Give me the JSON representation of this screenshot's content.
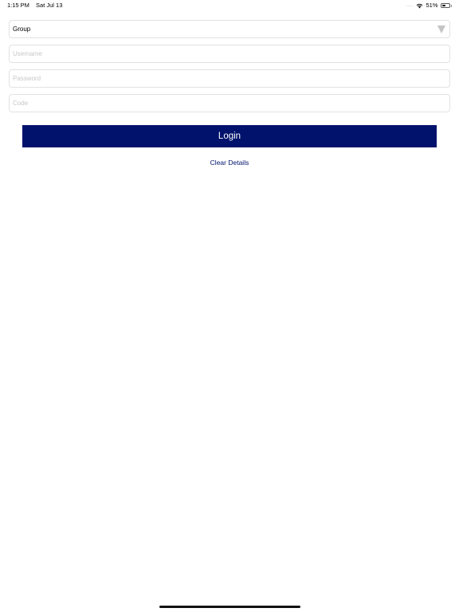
{
  "status_bar": {
    "time": "1:15 PM",
    "date": "Sat Jul 13",
    "battery_percent": "51%",
    "battery_level": 0.51,
    "wifi_icon": "wifi-icon",
    "battery_icon": "battery-icon"
  },
  "form": {
    "group": {
      "value": "Group",
      "icon": "dropdown-arrow-icon"
    },
    "username": {
      "value": "",
      "placeholder": "Username"
    },
    "password": {
      "value": "",
      "placeholder": "Password"
    },
    "code": {
      "value": "",
      "placeholder": "Code"
    }
  },
  "actions": {
    "login_label": "Login",
    "clear_label": "Clear Details"
  },
  "colors": {
    "primary": "#00126b",
    "field_border": "#e2e2e2",
    "placeholder": "#c8c8c8",
    "arrow": "#c4c4c4"
  }
}
